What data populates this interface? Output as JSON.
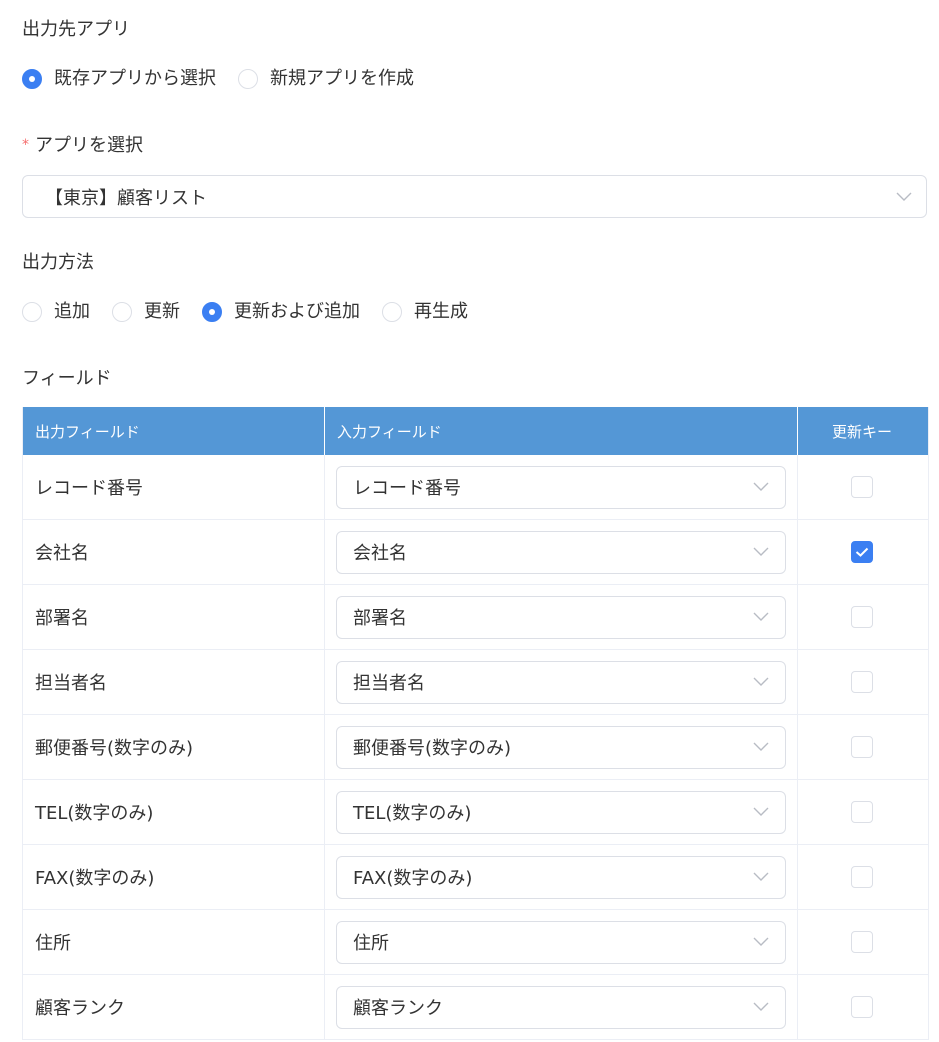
{
  "output_app": {
    "label": "出力先アプリ",
    "options": [
      {
        "label": "既存アプリから選択",
        "selected": true
      },
      {
        "label": "新規アプリを作成",
        "selected": false
      }
    ]
  },
  "select_app": {
    "required_mark": "*",
    "label": "アプリを選択",
    "value": "【東京】顧客リスト"
  },
  "output_method": {
    "label": "出力方法",
    "options": [
      {
        "label": "追加",
        "selected": false
      },
      {
        "label": "更新",
        "selected": false
      },
      {
        "label": "更新および追加",
        "selected": true
      },
      {
        "label": "再生成",
        "selected": false
      }
    ]
  },
  "fields": {
    "label": "フィールド",
    "columns": [
      "出力フィールド",
      "入力フィールド",
      "更新キー"
    ],
    "rows": [
      {
        "output": "レコード番号",
        "input": "レコード番号",
        "key": false
      },
      {
        "output": "会社名",
        "input": "会社名",
        "key": true
      },
      {
        "output": "部署名",
        "input": "部署名",
        "key": false
      },
      {
        "output": "担当者名",
        "input": "担当者名",
        "key": false
      },
      {
        "output": "郵便番号(数字のみ)",
        "input": "郵便番号(数字のみ)",
        "key": false
      },
      {
        "output": "TEL(数字のみ)",
        "input": "TEL(数字のみ)",
        "key": false
      },
      {
        "output": "FAX(数字のみ)",
        "input": "FAX(数字のみ)",
        "key": false
      },
      {
        "output": "住所",
        "input": "住所",
        "key": false
      },
      {
        "output": "顧客ランク",
        "input": "顧客ランク",
        "key": false
      }
    ]
  },
  "colors": {
    "accent": "#3b7ff2",
    "header_bg": "#5497d6",
    "required": "#f56c6c"
  }
}
